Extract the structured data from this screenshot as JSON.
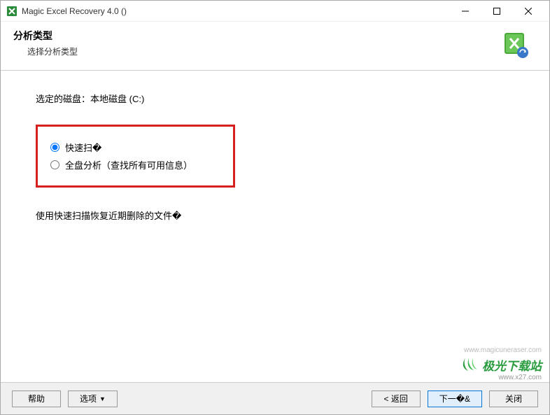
{
  "window": {
    "title": "Magic Excel Recovery 4.0 ()"
  },
  "header": {
    "title": "分析类型",
    "subtitle": "选择分析类型"
  },
  "content": {
    "disk_label": "选定的磁盘：本地磁盘 (C:)",
    "option_quick": "快速扫�",
    "option_full": "全盘分析（查找所有可用信息）",
    "description": "使用快速扫描恢复近期删除的文件�"
  },
  "buttons": {
    "help": "帮助",
    "options": "选项",
    "back": "< 返回",
    "next": "下一�&",
    "close": "关闭"
  },
  "watermark": {
    "url": "www.magicuneraser.com",
    "brand": "极光下载站",
    "site": "www.x27.com"
  }
}
